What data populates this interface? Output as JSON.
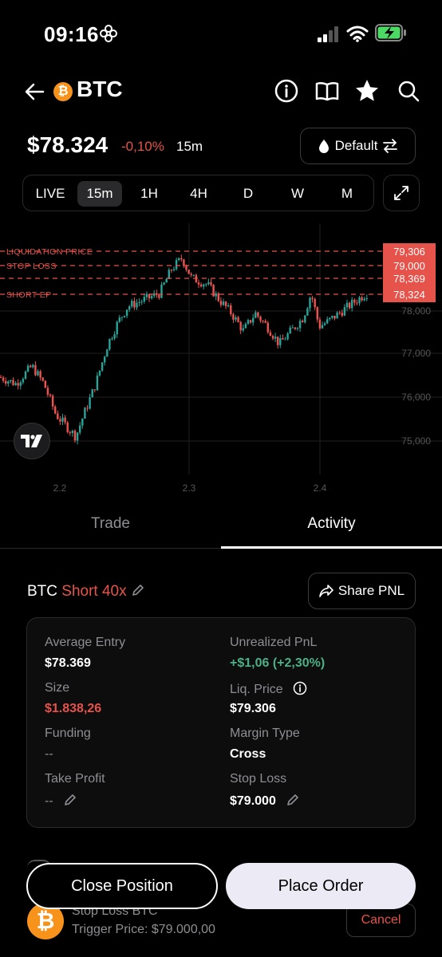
{
  "status_bar": {
    "time": "09:16"
  },
  "header": {
    "title": "BTC",
    "coin_glyph": "₿"
  },
  "price": {
    "value": "$78.324",
    "change": "-0,10%",
    "timeframe": "15m"
  },
  "default_button": {
    "label": "Default"
  },
  "timeframes": [
    "LIVE",
    "15m",
    "1H",
    "4H",
    "D",
    "W",
    "M"
  ],
  "active_timeframe": "15m",
  "chart": {
    "price_lines": [
      {
        "label": "LIQUIDATION PRICE",
        "value": "79,306"
      },
      {
        "label": "STOP LOSS",
        "value": "79,000"
      },
      {
        "label": "",
        "value": "78,369"
      },
      {
        "label": "SHORT EP",
        "value": "78,324"
      }
    ],
    "y_ticks": [
      "78,000",
      "77,000",
      "76,000",
      "75,000"
    ],
    "x_ticks": [
      "2.2",
      "2.3",
      "2.4"
    ],
    "colors": {
      "up": "#26a69a",
      "down": "#ef5350",
      "line": "#e5534b"
    }
  },
  "tabs": {
    "trade": "Trade",
    "activity": "Activity"
  },
  "position": {
    "symbol": "BTC",
    "side": "Short 40x",
    "share_label": "Share PNL",
    "fields": {
      "avg_entry_label": "Average Entry",
      "avg_entry": "$78.369",
      "upnl_label": "Unrealized PnL",
      "upnl": "+$1,06 (+2,30%)",
      "size_label": "Size",
      "size": "$1.838,26",
      "liq_label": "Liq. Price",
      "liq": "$79.306",
      "funding_label": "Funding",
      "funding": "--",
      "margin_label": "Margin Type",
      "margin": "Cross",
      "tp_label": "Take Profit",
      "tp": "--",
      "sl_label": "Stop Loss",
      "sl": "$79.000"
    }
  },
  "order": {
    "name": "Stop Loss BTC",
    "trigger": "Trigger Price: $79.000,00",
    "cancel": "Cancel"
  },
  "buttons": {
    "close": "Close Position",
    "place": "Place Order"
  },
  "brand": {
    "coin_color": "#f7931a",
    "accent_red": "#e5534b",
    "accent_green": "#4caf87"
  }
}
